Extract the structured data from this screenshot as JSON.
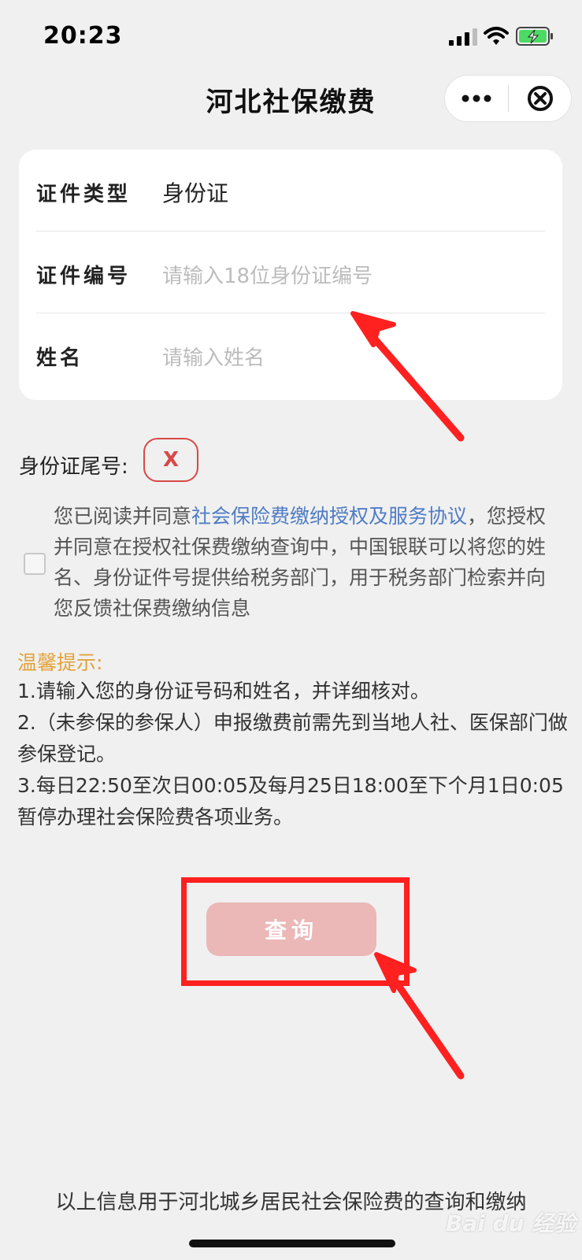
{
  "status_bar": {
    "time": "20:23"
  },
  "nav": {
    "title": "河北社保缴费"
  },
  "form": {
    "id_type": {
      "label": "证件类型",
      "value": "身份证"
    },
    "id_number": {
      "label": "证件编号",
      "placeholder": "请输入18位身份证编号"
    },
    "name": {
      "label": "姓名",
      "placeholder": "请输入姓名"
    }
  },
  "id_tail": {
    "label": "身份证尾号:",
    "value": "X"
  },
  "agreement": {
    "prefix": "您已阅读并同意",
    "link": "社会保险费缴纳授权及服务协议",
    "suffix": "，您授权并同意在授权社保费缴纳查询中，中国银联可以将您的姓名、身份证件号提供给税务部门，用于税务部门检索并向您反馈社保费缴纳信息"
  },
  "tips": {
    "title": "温馨提示:",
    "items": [
      "1.请输入您的身份证号码和姓名，并详细核对。",
      "2.（未参保的参保人）申报缴费前需先到当地人社、医保部门做参保登记。",
      "3.每日22:50至次日00:05及每月25日18:00至下个月1日0:05暂停办理社会保险费各项业务。"
    ]
  },
  "query_button": {
    "label": "查询"
  },
  "footer": {
    "note": "以上信息用于河北城乡居民社会保险费的查询和缴纳"
  },
  "watermark": {
    "text": "Bai du 经验"
  },
  "colors": {
    "accent_link": "#4f7cc4",
    "tips_title": "#e3a23a",
    "button_disabled": "#ebb7b7",
    "annotation_red": "#ff2020"
  }
}
